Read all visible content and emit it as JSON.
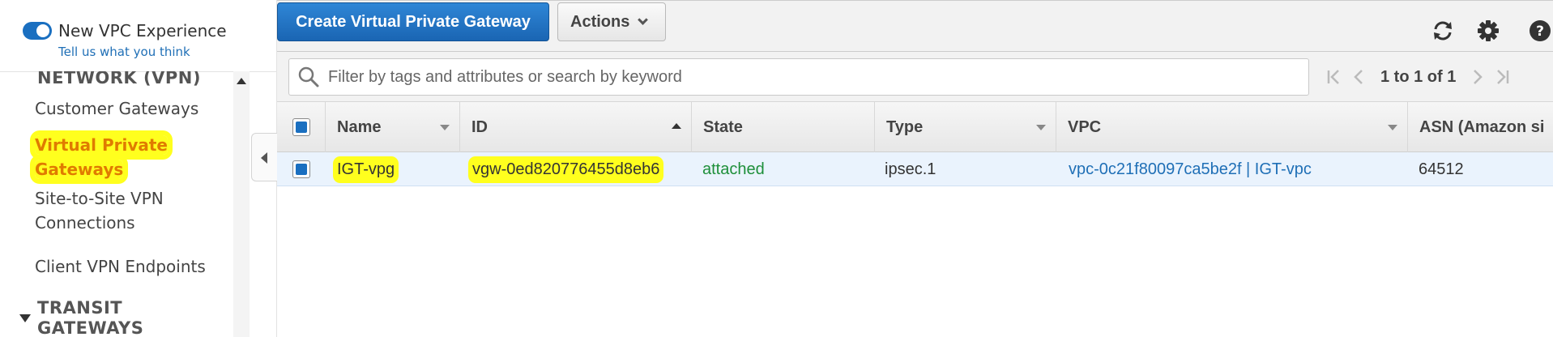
{
  "sidebar": {
    "vpc_experience_label": "New VPC Experience",
    "feedback_link": "Tell us what you think",
    "section_vpn": "NETWORK (VPN)",
    "items": [
      {
        "label": "Customer Gateways"
      },
      {
        "label_line1": "Virtual Private",
        "label_line2": "Gateways",
        "active": true
      },
      {
        "label_line1": "Site-to-Site VPN",
        "label_line2": "Connections"
      },
      {
        "label": "Client VPN Endpoints"
      }
    ],
    "section_transit_line1": "TRANSIT",
    "section_transit_line2": "GATEWAYS"
  },
  "toolbar": {
    "create_label": "Create Virtual Private Gateway",
    "actions_label": "Actions",
    "icons": [
      "refresh-icon",
      "gear-icon",
      "help-icon"
    ]
  },
  "search": {
    "placeholder": "Filter by tags and attributes or search by keyword"
  },
  "pagination": {
    "text": "1 to 1 of 1"
  },
  "table": {
    "columns": [
      "Name",
      "ID",
      "State",
      "Type",
      "VPC",
      "ASN (Amazon si"
    ],
    "rows": [
      {
        "name": "IGT-vpg",
        "id": "vgw-0ed820776455d8eb6",
        "state": "attached",
        "type": "ipsec.1",
        "vpc": "vpc-0c21f80097ca5be2f | IGT-vpc",
        "asn": "64512"
      }
    ]
  },
  "colors": {
    "primary": "#1a6fc0",
    "active_nav": "#e07b00",
    "highlight": "#ffff1e",
    "state_attached": "#1e8f3a",
    "link": "#1f6fb6"
  }
}
